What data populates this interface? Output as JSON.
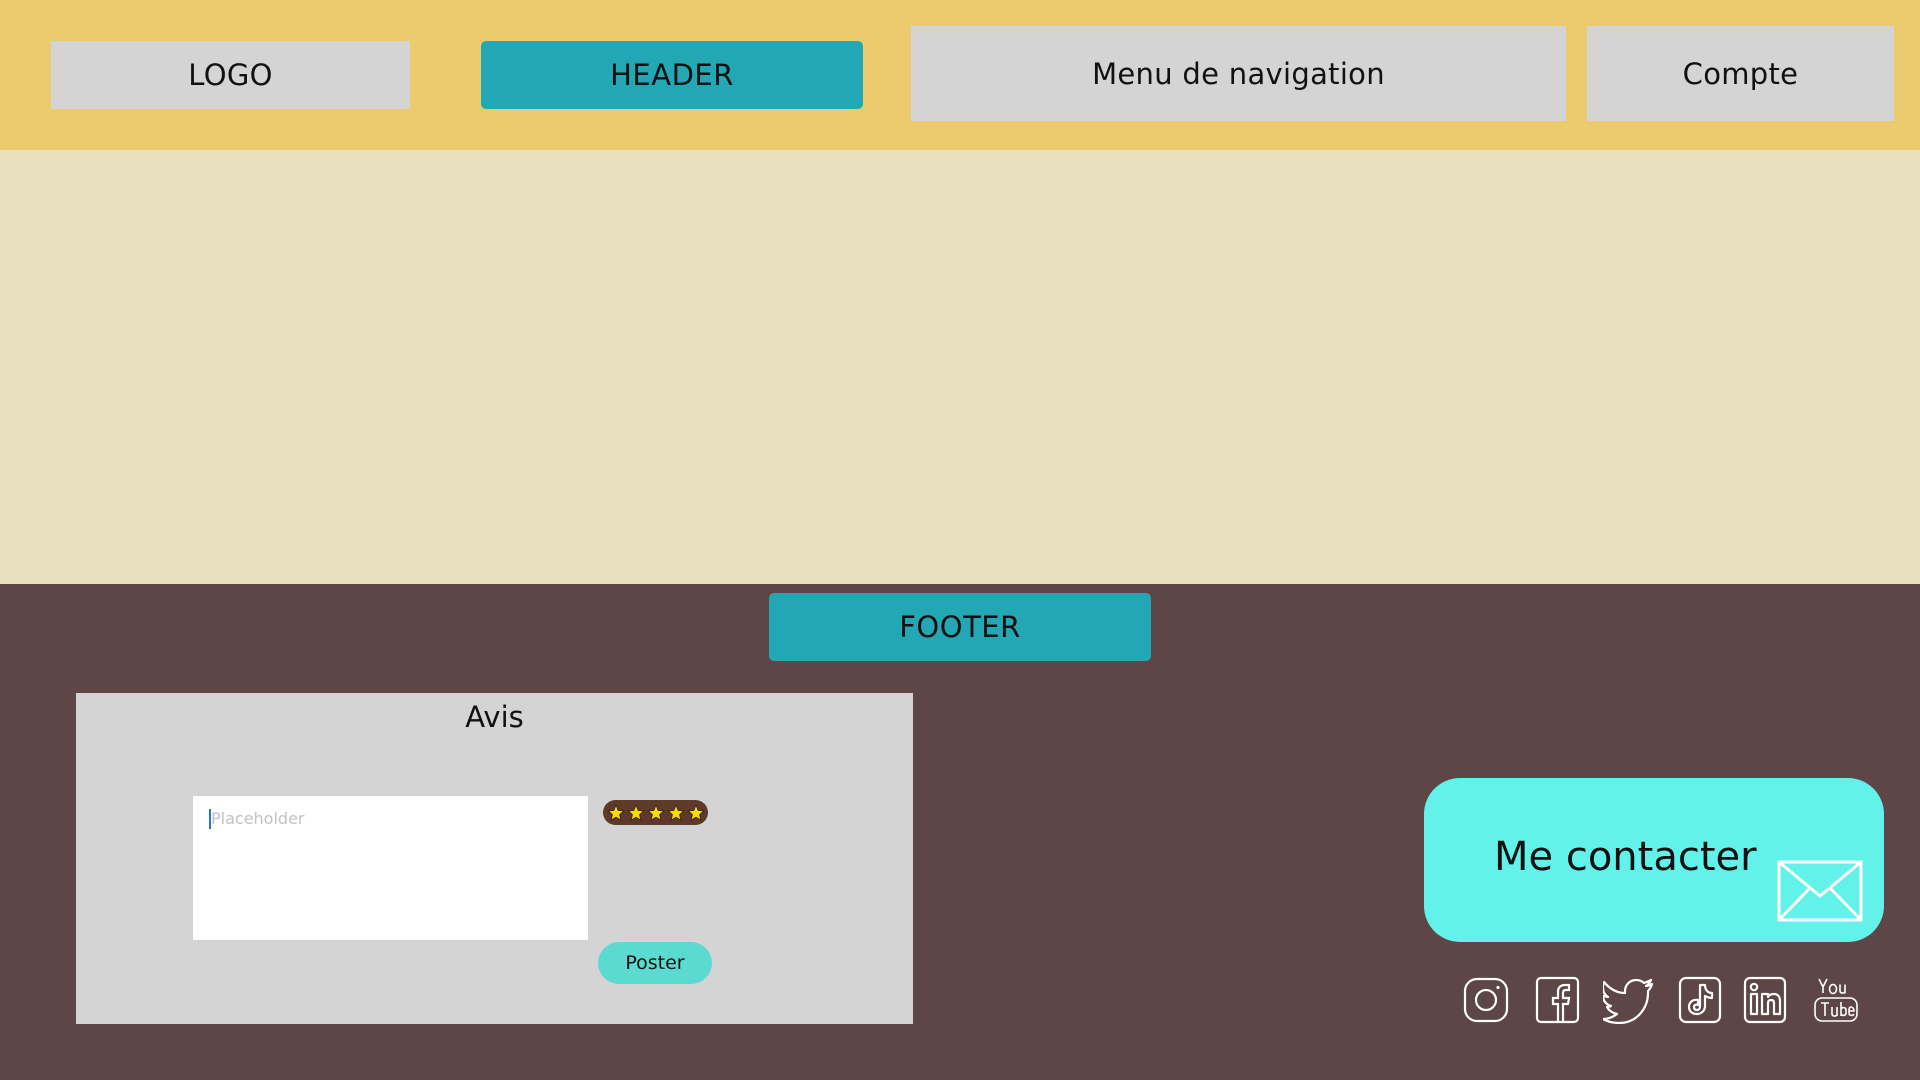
{
  "header": {
    "logo_label": "LOGO",
    "section_label": "HEADER",
    "nav_label": "Menu de navigation",
    "account_label": "Compte"
  },
  "footer": {
    "section_label": "FOOTER",
    "review": {
      "title": "Avis",
      "input_placeholder": "Placeholder",
      "input_value": "",
      "rating_stars": 5,
      "rating_max": 5,
      "post_label": "Poster"
    },
    "contact": {
      "label": "Me contacter",
      "icon": "mail-icon"
    },
    "socials": [
      {
        "icon": "instagram-icon"
      },
      {
        "icon": "facebook-icon"
      },
      {
        "icon": "twitter-icon"
      },
      {
        "icon": "tiktok-icon"
      },
      {
        "icon": "linkedin-icon"
      },
      {
        "icon": "youtube-icon"
      }
    ]
  },
  "colors": {
    "header_band": "#ebcb6e",
    "main_content": "#e9e0bf",
    "footer_band": "#5e4546",
    "section_label_teal": "#24a7b5",
    "placeholder_gray": "#d4d4d4",
    "contact_button": "#62f2ea",
    "post_button": "#5adad1",
    "star": "#f7dc0a"
  }
}
